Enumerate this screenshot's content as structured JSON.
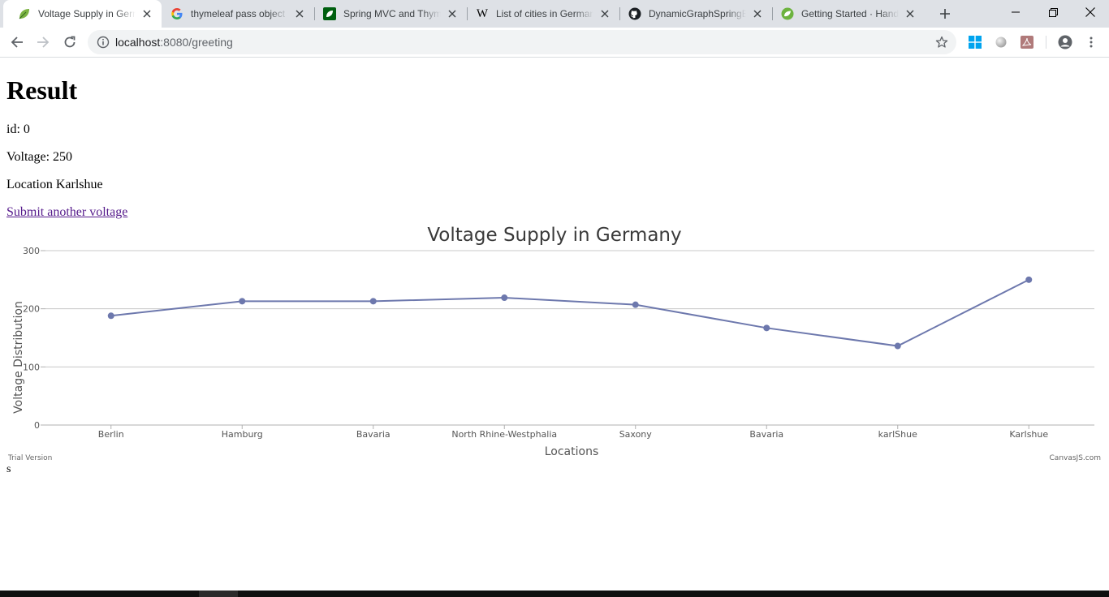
{
  "browser": {
    "tabs": [
      {
        "title": "Voltage Supply in Germany",
        "favicon": "leaf-icon",
        "active": true
      },
      {
        "title": "thymeleaf pass object to",
        "favicon": "google-icon",
        "active": false
      },
      {
        "title": "Spring MVC and Thymeleaf",
        "favicon": "leaf-green-square-icon",
        "active": false
      },
      {
        "title": "List of cities in Germany",
        "favicon": "wikipedia-icon",
        "active": false
      },
      {
        "title": "DynamicGraphSpringBoot",
        "favicon": "github-icon",
        "active": false
      },
      {
        "title": "Getting Started · Handling",
        "favicon": "spring-icon",
        "active": false
      }
    ],
    "url": {
      "host": "localhost",
      "path": ":8080/greeting"
    }
  },
  "page": {
    "heading": "Result",
    "id_line": "id: 0",
    "voltage_line": "Voltage: 250",
    "location_line": "Location Karlshue",
    "link_text": "Submit another voltage",
    "footer_text": "s"
  },
  "chart_data": {
    "type": "line",
    "title": "Voltage Supply in Germany",
    "xlabel": "Locations",
    "ylabel": "Voltage Distribution",
    "categories": [
      "Berlin",
      "Hamburg",
      "Bavaria",
      "North Rhine-Westphalia",
      "Saxony",
      "Bavaria",
      "karlShue",
      "Karlshue"
    ],
    "values": [
      188,
      213,
      213,
      219,
      207,
      167,
      136,
      250
    ],
    "ylim": [
      0,
      300
    ],
    "yticks": [
      0,
      100,
      200,
      300
    ],
    "grid": true,
    "line_color": "#6d78ad",
    "trial_text": "Trial Version",
    "credit_text": "CanvasJS.com"
  }
}
